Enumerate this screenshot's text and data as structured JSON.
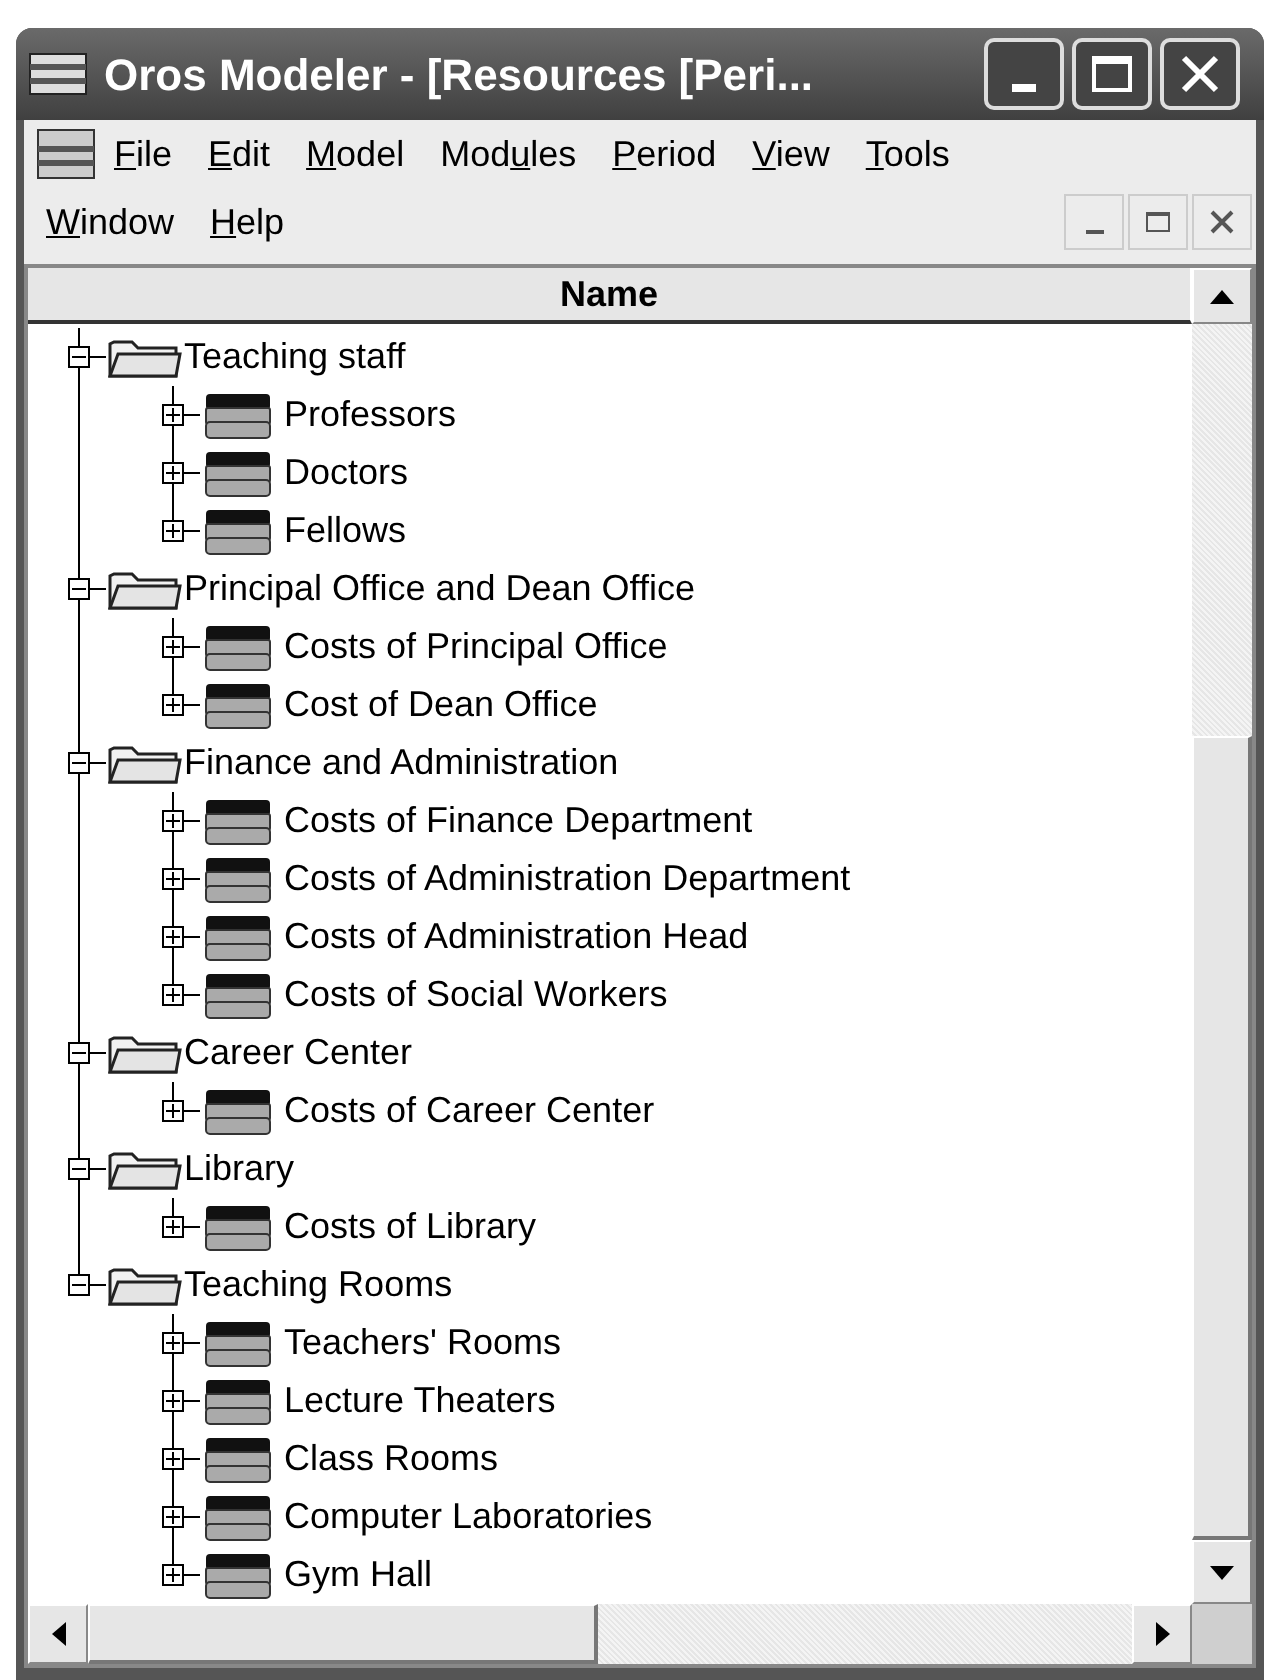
{
  "window": {
    "title": "Oros Modeler - [Resources [Peri..."
  },
  "menu": [
    {
      "key": "F",
      "rest": "ile"
    },
    {
      "key": "E",
      "rest": "dit"
    },
    {
      "key": "M",
      "rest": "odel"
    },
    {
      "prefix": "Mod",
      "key": "u",
      "rest": "les"
    },
    {
      "key": "P",
      "rest": "eriod"
    },
    {
      "key": "V",
      "rest": "iew"
    },
    {
      "key": "T",
      "rest": "ools"
    },
    {
      "key": "W",
      "rest": "indow"
    },
    {
      "key": "H",
      "rest": "elp"
    }
  ],
  "column_header": "Name",
  "tree": [
    {
      "label": "Teaching staff",
      "expanded": true,
      "children": [
        {
          "label": "Professors",
          "expanded": false
        },
        {
          "label": "Doctors",
          "expanded": false
        },
        {
          "label": "Fellows",
          "expanded": false
        }
      ]
    },
    {
      "label": "Principal Office and Dean Office",
      "expanded": true,
      "children": [
        {
          "label": "Costs of Principal Office",
          "expanded": false
        },
        {
          "label": "Cost of Dean Office",
          "expanded": false
        }
      ]
    },
    {
      "label": "Finance and Administration",
      "expanded": true,
      "children": [
        {
          "label": "Costs of Finance Department",
          "expanded": false
        },
        {
          "label": "Costs of Administration Department",
          "expanded": false
        },
        {
          "label": "Costs of Administration Head",
          "expanded": false
        },
        {
          "label": "Costs of Social Workers",
          "expanded": false
        }
      ]
    },
    {
      "label": "Career Center",
      "expanded": true,
      "children": [
        {
          "label": "Costs of Career Center",
          "expanded": false
        }
      ]
    },
    {
      "label": "Library",
      "expanded": true,
      "children": [
        {
          "label": "Costs of Library",
          "expanded": false
        }
      ]
    },
    {
      "label": "Teaching Rooms",
      "expanded": true,
      "children": [
        {
          "label": "Teachers' Rooms",
          "expanded": false
        },
        {
          "label": "Lecture Theaters",
          "expanded": false
        },
        {
          "label": "Class Rooms",
          "expanded": false
        },
        {
          "label": "Computer Laboratories",
          "expanded": false
        },
        {
          "label": "Gym Hall",
          "expanded": false
        }
      ]
    }
  ]
}
